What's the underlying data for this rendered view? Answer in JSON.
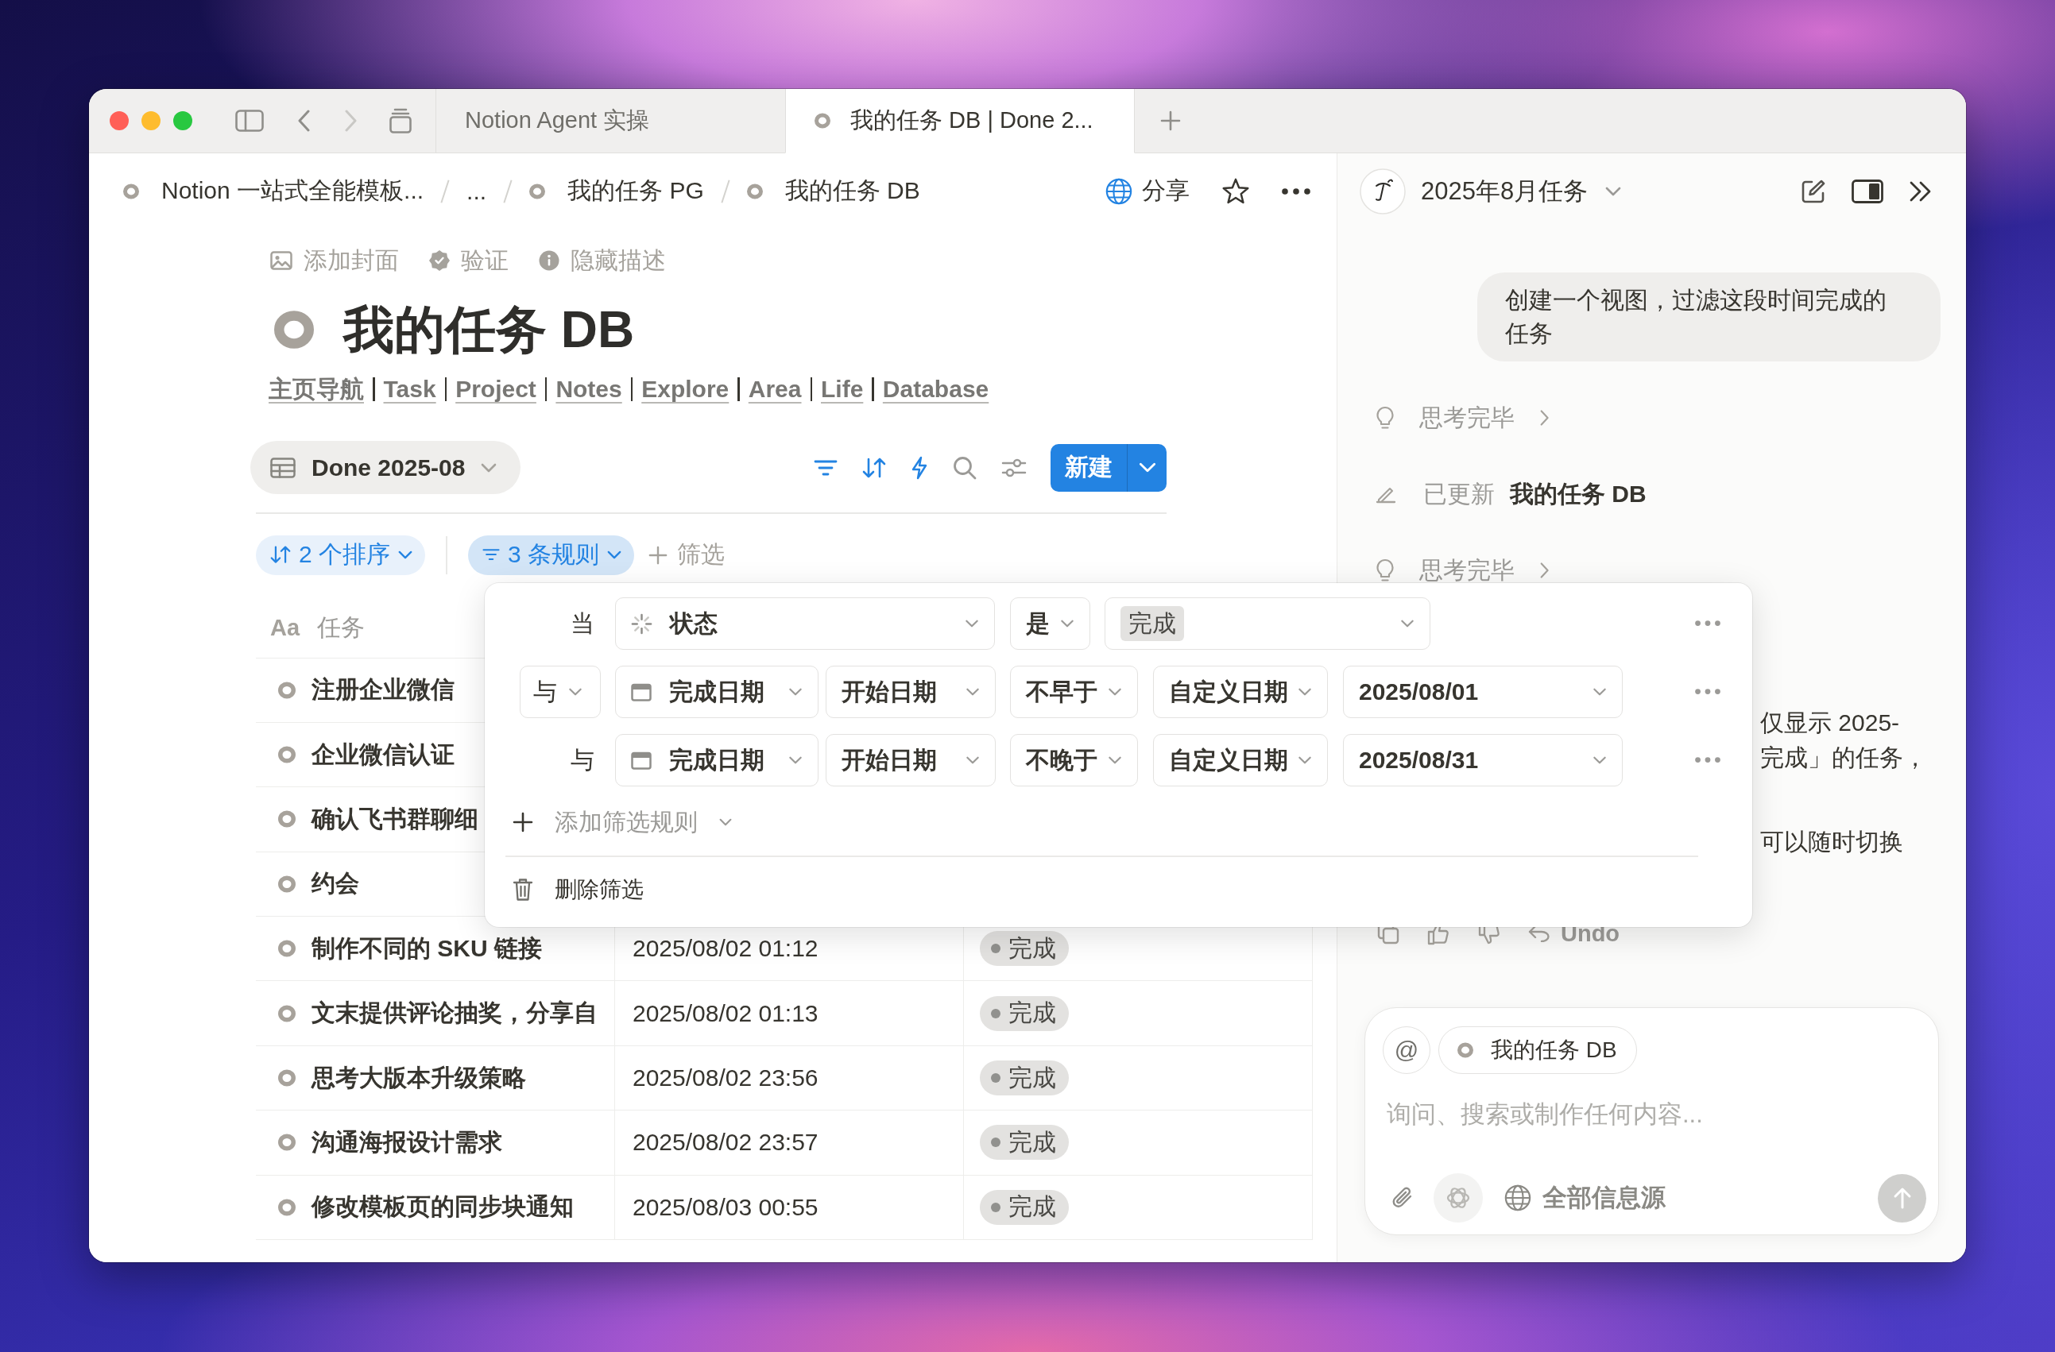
{
  "window": {
    "tabs": [
      {
        "label": "Notion Agent 实操",
        "selected": false,
        "icon": false
      },
      {
        "label": "我的任务 DB | Done 2...",
        "selected": true,
        "icon": true
      }
    ]
  },
  "breadcrumb": [
    {
      "label": "Notion 一站式全能模板...",
      "icon": true
    },
    {
      "label": "...",
      "icon": false
    },
    {
      "label": "我的任务 PG",
      "icon": true
    },
    {
      "label": "我的任务 DB",
      "icon": true
    }
  ],
  "page_header": {
    "share": "分享",
    "favorite": false
  },
  "page_actions": [
    {
      "kind": "cover",
      "label": "添加封面"
    },
    {
      "kind": "verify",
      "label": "验证"
    },
    {
      "kind": "description",
      "label": "隐藏描述"
    }
  ],
  "title": "我的任务 DB",
  "nav_links": [
    "主页导航",
    "Task",
    "Project",
    "Notes",
    "Explore",
    "Area",
    "Life",
    "Database"
  ],
  "view": {
    "label": "Done 2025-08",
    "tools": [
      {
        "kind": "filter",
        "active": true
      },
      {
        "kind": "sort",
        "active": true
      },
      {
        "kind": "automation",
        "active": true
      },
      {
        "kind": "search",
        "active": false
      },
      {
        "kind": "settings",
        "active": false
      }
    ],
    "new_button": "新建"
  },
  "view_chips": [
    {
      "kind": "sort",
      "label": "2 个排序",
      "selected": false
    },
    {
      "kind": "filter",
      "label": "3 条规则",
      "selected": true
    }
  ],
  "add_filter": "筛选",
  "table": {
    "columns": [
      {
        "label": "任务",
        "type_icon": "Aa"
      }
    ],
    "rows": [
      {
        "task": "注册企业微信"
      },
      {
        "task": "企业微信认证"
      },
      {
        "task": "确认飞书群聊细"
      },
      {
        "task": "约会"
      },
      {
        "task": "制作不同的 SKU 链接",
        "date": "2025/08/02 01:12",
        "status": "完成"
      },
      {
        "task": "文末提供评论抽奖，分享自",
        "date": "2025/08/02 01:13",
        "status": "完成"
      },
      {
        "task": "思考大版本升级策略",
        "date": "2025/08/02 23:56",
        "status": "完成"
      },
      {
        "task": "沟通海报设计需求",
        "date": "2025/08/02 23:57",
        "status": "完成"
      },
      {
        "task": "修改模板页的同步块通知",
        "date": "2025/08/03 00:55",
        "status": "完成"
      }
    ]
  },
  "filter_panel": {
    "rules": [
      {
        "kind": "status",
        "conjunction": "当",
        "conjunction_menu": false,
        "property": "状态",
        "operator": "是",
        "value": "完成"
      },
      {
        "kind": "date",
        "conjunction": "与",
        "conjunction_menu": true,
        "property": "完成日期",
        "date_part": "开始日期",
        "operator": "不早于",
        "date_mode": "自定义日期",
        "value": "2025/08/01"
      },
      {
        "kind": "date",
        "conjunction": "与",
        "conjunction_menu": false,
        "property": "完成日期",
        "date_part": "开始日期",
        "operator": "不晚于",
        "date_mode": "自定义日期",
        "value": "2025/08/31"
      }
    ],
    "add_rule": "添加筛选规则",
    "delete": "删除筛选"
  },
  "assistant": {
    "title": "2025年8月任务",
    "messages": [
      {
        "kind": "user",
        "text": "创建一个视图，过滤这段时间完成的任务"
      },
      {
        "kind": "thought",
        "text": "思考完毕"
      },
      {
        "kind": "update",
        "label": "已更新",
        "target": "我的任务 DB"
      },
      {
        "kind": "thought",
        "text": "思考完毕"
      },
      {
        "kind": "reply",
        "lines": [
          "仅显示 2025-",
          "完成」的任务，"
        ]
      },
      {
        "kind": "reply",
        "lines": [
          "可以随时切换"
        ]
      }
    ],
    "undo": "Undo",
    "composer": {
      "mention": "@",
      "context": "我的任务 DB",
      "placeholder": "询问、搜索或制作任何内容...",
      "sources": "全部信息源"
    }
  }
}
